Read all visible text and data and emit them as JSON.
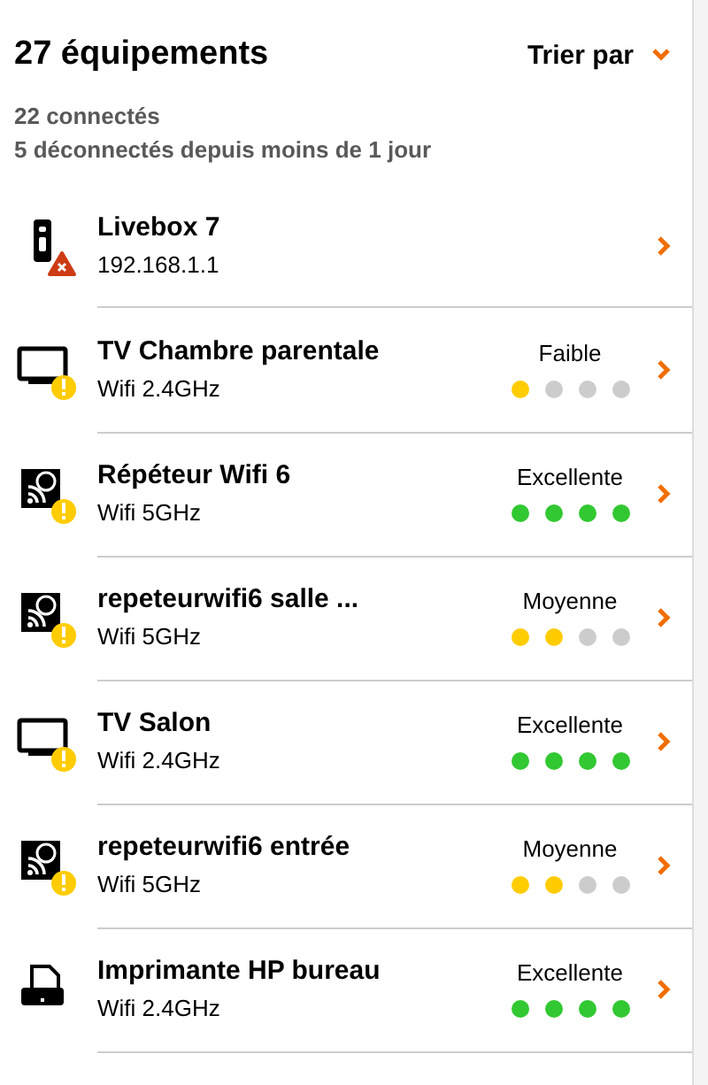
{
  "header": {
    "title": "27 équipements",
    "sort_label": "Trier par"
  },
  "summary": [
    "22 connectés",
    "5 déconnectés depuis moins de 1 jour"
  ],
  "devices": [
    {
      "kind": "box",
      "error": true,
      "warning": false,
      "name": "Livebox 7",
      "detail": "192.168.1.1"
    },
    {
      "kind": "tv",
      "error": false,
      "warning": true,
      "name": "TV Chambre parentale",
      "detail": "Wifi 2.4GHz",
      "signal": "Faible",
      "stars": 1
    },
    {
      "kind": "repeater",
      "error": false,
      "warning": true,
      "name": "Répéteur Wifi 6",
      "detail": "Wifi 5GHz",
      "signal": "Excellente",
      "stars": 4
    },
    {
      "kind": "repeater",
      "error": false,
      "warning": true,
      "name": "repeteurwifi6 salle ...",
      "detail": "Wifi 5GHz",
      "signal": "Moyenne",
      "stars": 2
    },
    {
      "kind": "tv",
      "error": false,
      "warning": true,
      "name": "TV Salon",
      "detail": "Wifi 2.4GHz",
      "signal": "Excellente",
      "stars": 4
    },
    {
      "kind": "repeater",
      "error": false,
      "warning": true,
      "name": "repeteurwifi6 entrée",
      "detail": "Wifi 5GHz",
      "signal": "Moyenne",
      "stars": 2
    },
    {
      "kind": "printer",
      "error": false,
      "warning": false,
      "name": "Imprimante HP bureau",
      "detail": "Wifi 2.4GHz",
      "signal": "Excellente",
      "stars": 4
    }
  ]
}
